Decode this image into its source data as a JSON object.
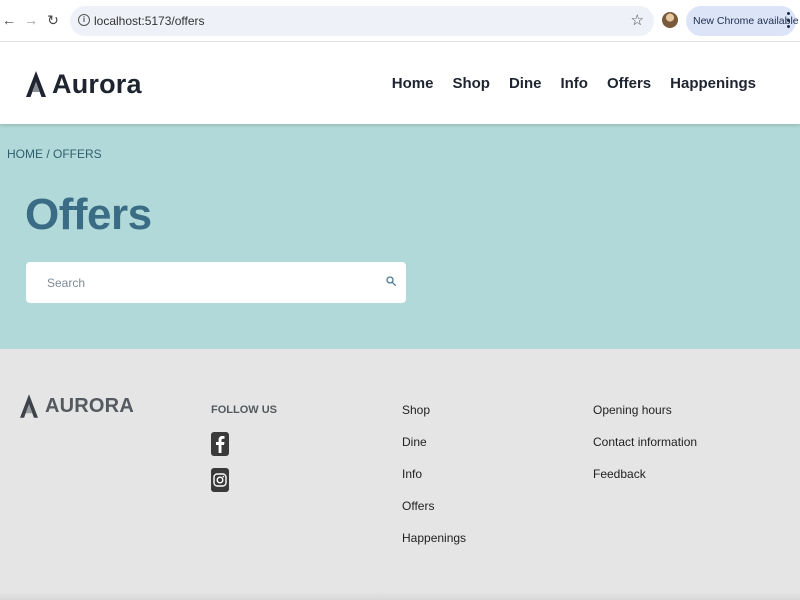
{
  "browser": {
    "url": "localhost:5173/offers",
    "update_label": "New Chrome available",
    "back_glyph": "←",
    "forward_glyph": "→",
    "reload_glyph": "↻",
    "info_glyph": "i",
    "star_glyph": "☆"
  },
  "header": {
    "brand": "Aurora",
    "nav": [
      "Home",
      "Shop",
      "Dine",
      "Info",
      "Offers",
      "Happenings"
    ]
  },
  "hero": {
    "breadcrumb": "HOME / OFFERS",
    "title": "Offers",
    "search_placeholder": "Search"
  },
  "footer": {
    "brand": "AURORA",
    "follow_title": "FOLLOW US",
    "col1": [
      "Shop",
      "Dine",
      "Info",
      "Offers",
      "Happenings"
    ],
    "col2": [
      "Opening hours",
      "Contact information",
      "Feedback"
    ]
  },
  "icons": {
    "logo": "aurora-logo-icon",
    "search": "search-icon",
    "facebook": "facebook-icon",
    "instagram": "instagram-icon"
  },
  "colors": {
    "hero_bg": "#b2d9d9",
    "title": "#3a6c85",
    "footer_bg": "#e4e5e4"
  }
}
